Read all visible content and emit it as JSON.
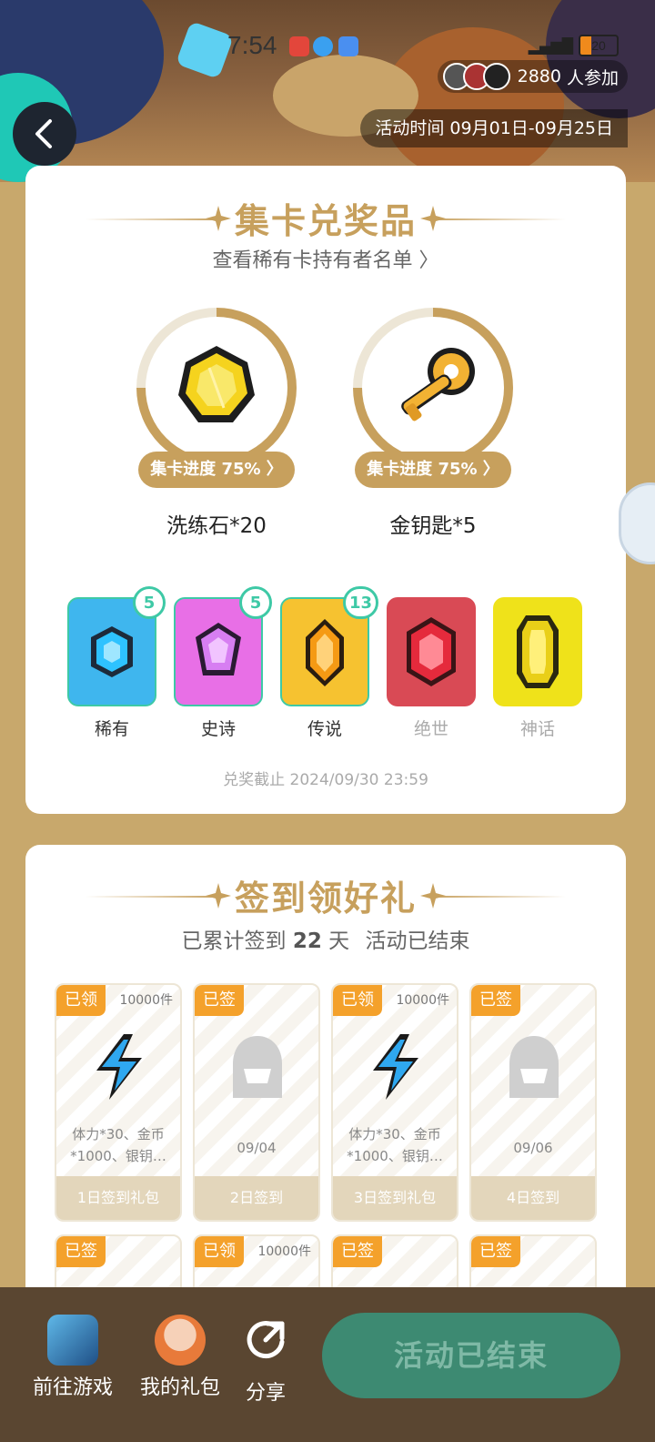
{
  "status_bar": {
    "time": "7:54",
    "battery": "20"
  },
  "banner": {
    "participants_count": "2880",
    "participants_suffix": "人参加",
    "period": "活动时间 09月01日-09月25日"
  },
  "collect": {
    "title": "集卡兑奖品",
    "rare_list_link": "查看稀有卡持有者名单 〉",
    "prizes": [
      {
        "name": "洗练石*20",
        "progress_label": "集卡进度 75% 〉",
        "progress": 0.75,
        "icon": "yellow-gem-icon"
      },
      {
        "name": "金钥匙*5",
        "progress_label": "集卡进度 75% 〉",
        "progress": 0.75,
        "icon": "gold-key-icon"
      }
    ],
    "rarities": [
      {
        "name": "稀有",
        "count": "5",
        "color": "#3fb6ee",
        "owned": true
      },
      {
        "name": "史诗",
        "count": "5",
        "color": "#e86fe6",
        "owned": true
      },
      {
        "name": "传说",
        "count": "13",
        "color": "#f6c230",
        "owned": true
      },
      {
        "name": "绝世",
        "count": "",
        "color": "#d94a55",
        "owned": false
      },
      {
        "name": "神话",
        "count": "",
        "color": "#efe21a",
        "owned": false
      }
    ],
    "deadline": "兑奖截止 2024/09/30 23:59"
  },
  "checkin": {
    "title": "签到领好礼",
    "info_prefix": "已累计签到",
    "days": "22",
    "info_suffix": "天",
    "status": "活动已结束",
    "items": [
      {
        "tag": "已领",
        "qty": "10000件",
        "desc1": "体力*30、金币",
        "desc2": "*1000、银钥…",
        "footer": "1日签到礼包",
        "type": "gift"
      },
      {
        "tag": "已签",
        "qty": "",
        "date": "09/04",
        "footer": "2日签到",
        "type": "plain"
      },
      {
        "tag": "已领",
        "qty": "10000件",
        "desc1": "体力*30、金币",
        "desc2": "*1000、银钥…",
        "footer": "3日签到礼包",
        "type": "gift"
      },
      {
        "tag": "已签",
        "qty": "",
        "date": "09/06",
        "footer": "4日签到",
        "type": "plain"
      },
      {
        "tag": "已签",
        "qty": ""
      },
      {
        "tag": "已领",
        "qty": "10000件"
      },
      {
        "tag": "已签",
        "qty": ""
      },
      {
        "tag": "已签",
        "qty": ""
      }
    ]
  },
  "bottom_bar": {
    "go_game": "前往游戏",
    "my_gifts": "我的礼包",
    "share": "分享",
    "ended": "活动已结束"
  }
}
